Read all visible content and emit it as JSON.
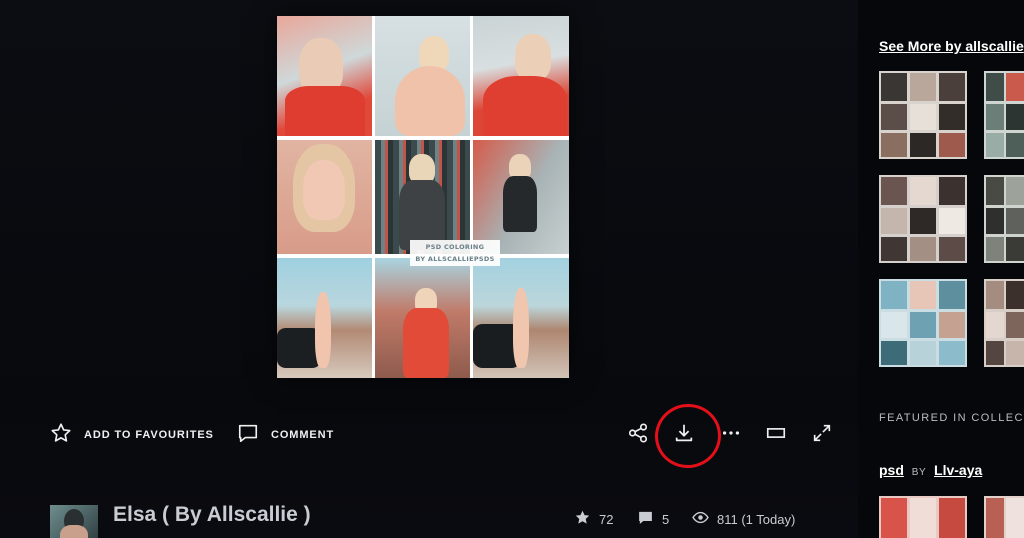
{
  "artwork": {
    "watermark_line1": "PSD COLORING",
    "watermark_line2": "BY ALLSCALLIEPSDS"
  },
  "actions": {
    "favourite_label": "ADD TO FAVOURITES",
    "comment_label": "COMMENT"
  },
  "deviation": {
    "title": "Elsa ( By Allscallie )",
    "favourites": "72",
    "comments": "5",
    "views": "811 (1 Today)"
  },
  "sidebar": {
    "see_more": "See More by allscallie",
    "featured_heading": "FEATURED IN COLLECTIONS",
    "collection_name": "psd",
    "collection_by": "BY",
    "collection_author": "Llv-aya"
  },
  "colors": {
    "annotation": "#e3101a",
    "accent_red": "#e04a3c"
  }
}
